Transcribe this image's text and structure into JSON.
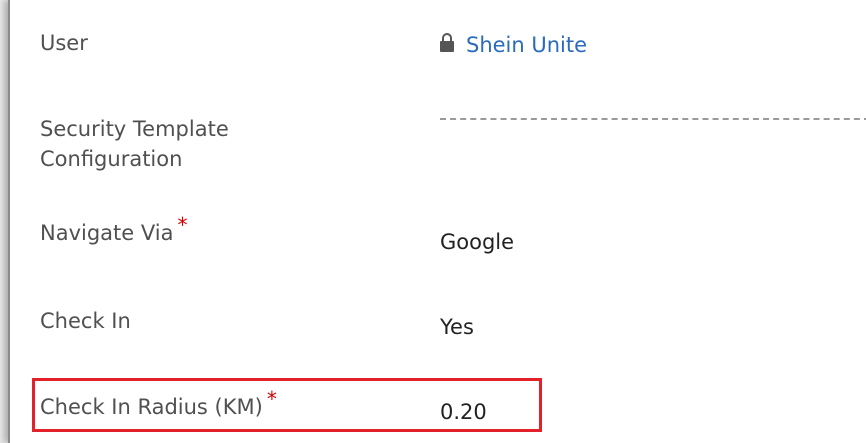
{
  "fields": [
    {
      "label": "User",
      "value": "Shein Unite",
      "locked": true,
      "is_link": true,
      "required": false
    },
    {
      "label_lines": [
        "Security Template",
        "Configuration"
      ],
      "value": "",
      "required": false
    },
    {
      "label": "Navigate Via",
      "value": "Google",
      "required": true
    },
    {
      "label": "Check In",
      "value": "Yes",
      "required": false
    },
    {
      "label": "Check In Radius (KM)",
      "value": "0.20",
      "required": true,
      "highlighted": true
    }
  ],
  "required_marker": "*",
  "icons": {
    "lock": "lock-icon"
  },
  "colors": {
    "link": "#2a6bbd",
    "required": "#d40000",
    "highlight": "#e3212b"
  }
}
